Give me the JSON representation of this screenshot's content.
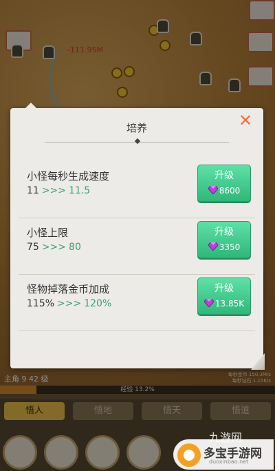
{
  "background": {
    "damage_text": "-111.95M",
    "player_level": "主角 9 42 级",
    "resource_lines": [
      "每秒金币 150.3M/s",
      "每秒钻石 1.15K/s"
    ],
    "exp_label": "经验 13.2%",
    "exp_fraction": 0.132,
    "tabs": [
      {
        "label": "悟人",
        "active": true
      },
      {
        "label": "悟地",
        "active": false
      },
      {
        "label": "悟天",
        "active": false
      },
      {
        "label": "悟道",
        "active": false
      }
    ]
  },
  "dialog": {
    "title": "培养",
    "close_icon": "close-icon",
    "rows": [
      {
        "name": "小怪每秒生成速度",
        "current": "11",
        "arrow": ">>>",
        "next": "11.5",
        "button_label": "升级",
        "cost": "8600",
        "cost_icon": "gem-icon"
      },
      {
        "name": "小怪上限",
        "current": "75",
        "arrow": ">>>",
        "next": "80",
        "button_label": "升级",
        "cost": "3350",
        "cost_icon": "gem-icon"
      },
      {
        "name": "怪物掉落金币加成",
        "current": "115%",
        "arrow": ">>>",
        "next": "120%",
        "button_label": "升级",
        "cost": "13.85K",
        "cost_icon": "gem-icon"
      }
    ]
  },
  "watermark": {
    "top_text": "九游网",
    "title": "多宝手游网",
    "subtitle": "duoxinbao.net"
  },
  "colors": {
    "accent_green": "#3aa072",
    "button_green": "#2fb87a",
    "close_orange": "#ff6a3d",
    "gem_purple": "#b03ad6"
  }
}
